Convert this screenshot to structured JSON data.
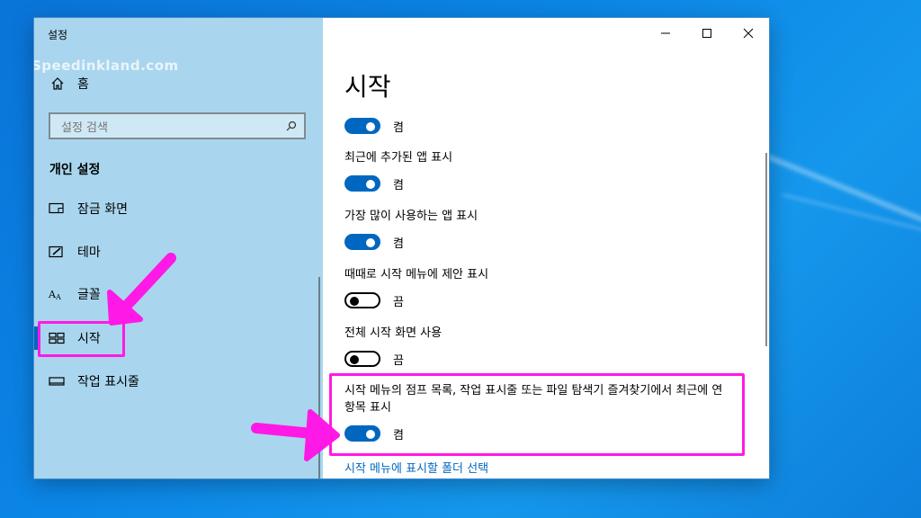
{
  "window": {
    "title": "설정",
    "watermark": "Speedinkland.com"
  },
  "sidebar": {
    "home_label": "홈",
    "search_placeholder": "설정 검색",
    "section_title": "개인 설정",
    "items": [
      {
        "label": "잠금 화면",
        "icon": "lock-screen-icon"
      },
      {
        "label": "테마",
        "icon": "theme-icon"
      },
      {
        "label": "글꼴",
        "icon": "font-icon"
      },
      {
        "label": "시작",
        "icon": "start-icon",
        "selected": true
      },
      {
        "label": "작업 표시줄",
        "icon": "taskbar-icon"
      }
    ]
  },
  "main": {
    "title": "시작",
    "settings": [
      {
        "label": "",
        "state": "켬",
        "on": true
      },
      {
        "label": "최근에 추가된 앱 표시",
        "state": "켬",
        "on": true
      },
      {
        "label": "가장 많이 사용하는 앱 표시",
        "state": "켬",
        "on": true
      },
      {
        "label": "때때로 시작 메뉴에 제안 표시",
        "state": "끔",
        "on": false
      },
      {
        "label": "전체 시작 화면 사용",
        "state": "끔",
        "on": false
      },
      {
        "label": "시작 메뉴의 점프 목록, 작업 표시줄 또는 파일 탐색기 즐겨찾기에서 최근에 연 항목 표시",
        "state": "켬",
        "on": true
      }
    ],
    "link": "시작 메뉴에 표시할 폴더 선택"
  },
  "colors": {
    "accent": "#0067c0",
    "highlight": "#ff19e6",
    "sidebar_bg": "#a9d6ee"
  }
}
